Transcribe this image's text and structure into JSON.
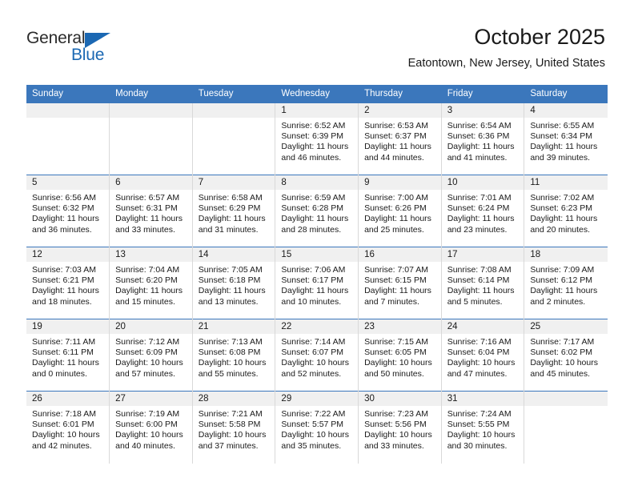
{
  "brand": {
    "name_line1": "General",
    "name_line2": "Blue",
    "accent_color": "#1b68b3"
  },
  "header": {
    "title": "October 2025",
    "subtitle": "Eatontown, New Jersey, United States"
  },
  "calendar": {
    "header_bg": "#3b77bc",
    "daynum_bg": "#f0f0f0",
    "weekday_headers": [
      "Sunday",
      "Monday",
      "Tuesday",
      "Wednesday",
      "Thursday",
      "Friday",
      "Saturday"
    ],
    "labels": {
      "sunrise": "Sunrise:",
      "sunset": "Sunset:",
      "daylight": "Daylight:"
    },
    "weeks": [
      [
        {
          "day": "",
          "empty": true
        },
        {
          "day": "",
          "empty": true
        },
        {
          "day": "",
          "empty": true
        },
        {
          "day": "1",
          "sunrise": "Sunrise: 6:52 AM",
          "sunset": "Sunset: 6:39 PM",
          "daylight": "Daylight: 11 hours and 46 minutes."
        },
        {
          "day": "2",
          "sunrise": "Sunrise: 6:53 AM",
          "sunset": "Sunset: 6:37 PM",
          "daylight": "Daylight: 11 hours and 44 minutes."
        },
        {
          "day": "3",
          "sunrise": "Sunrise: 6:54 AM",
          "sunset": "Sunset: 6:36 PM",
          "daylight": "Daylight: 11 hours and 41 minutes."
        },
        {
          "day": "4",
          "sunrise": "Sunrise: 6:55 AM",
          "sunset": "Sunset: 6:34 PM",
          "daylight": "Daylight: 11 hours and 39 minutes."
        }
      ],
      [
        {
          "day": "5",
          "sunrise": "Sunrise: 6:56 AM",
          "sunset": "Sunset: 6:32 PM",
          "daylight": "Daylight: 11 hours and 36 minutes."
        },
        {
          "day": "6",
          "sunrise": "Sunrise: 6:57 AM",
          "sunset": "Sunset: 6:31 PM",
          "daylight": "Daylight: 11 hours and 33 minutes."
        },
        {
          "day": "7",
          "sunrise": "Sunrise: 6:58 AM",
          "sunset": "Sunset: 6:29 PM",
          "daylight": "Daylight: 11 hours and 31 minutes."
        },
        {
          "day": "8",
          "sunrise": "Sunrise: 6:59 AM",
          "sunset": "Sunset: 6:28 PM",
          "daylight": "Daylight: 11 hours and 28 minutes."
        },
        {
          "day": "9",
          "sunrise": "Sunrise: 7:00 AM",
          "sunset": "Sunset: 6:26 PM",
          "daylight": "Daylight: 11 hours and 25 minutes."
        },
        {
          "day": "10",
          "sunrise": "Sunrise: 7:01 AM",
          "sunset": "Sunset: 6:24 PM",
          "daylight": "Daylight: 11 hours and 23 minutes."
        },
        {
          "day": "11",
          "sunrise": "Sunrise: 7:02 AM",
          "sunset": "Sunset: 6:23 PM",
          "daylight": "Daylight: 11 hours and 20 minutes."
        }
      ],
      [
        {
          "day": "12",
          "sunrise": "Sunrise: 7:03 AM",
          "sunset": "Sunset: 6:21 PM",
          "daylight": "Daylight: 11 hours and 18 minutes."
        },
        {
          "day": "13",
          "sunrise": "Sunrise: 7:04 AM",
          "sunset": "Sunset: 6:20 PM",
          "daylight": "Daylight: 11 hours and 15 minutes."
        },
        {
          "day": "14",
          "sunrise": "Sunrise: 7:05 AM",
          "sunset": "Sunset: 6:18 PM",
          "daylight": "Daylight: 11 hours and 13 minutes."
        },
        {
          "day": "15",
          "sunrise": "Sunrise: 7:06 AM",
          "sunset": "Sunset: 6:17 PM",
          "daylight": "Daylight: 11 hours and 10 minutes."
        },
        {
          "day": "16",
          "sunrise": "Sunrise: 7:07 AM",
          "sunset": "Sunset: 6:15 PM",
          "daylight": "Daylight: 11 hours and 7 minutes."
        },
        {
          "day": "17",
          "sunrise": "Sunrise: 7:08 AM",
          "sunset": "Sunset: 6:14 PM",
          "daylight": "Daylight: 11 hours and 5 minutes."
        },
        {
          "day": "18",
          "sunrise": "Sunrise: 7:09 AM",
          "sunset": "Sunset: 6:12 PM",
          "daylight": "Daylight: 11 hours and 2 minutes."
        }
      ],
      [
        {
          "day": "19",
          "sunrise": "Sunrise: 7:11 AM",
          "sunset": "Sunset: 6:11 PM",
          "daylight": "Daylight: 11 hours and 0 minutes."
        },
        {
          "day": "20",
          "sunrise": "Sunrise: 7:12 AM",
          "sunset": "Sunset: 6:09 PM",
          "daylight": "Daylight: 10 hours and 57 minutes."
        },
        {
          "day": "21",
          "sunrise": "Sunrise: 7:13 AM",
          "sunset": "Sunset: 6:08 PM",
          "daylight": "Daylight: 10 hours and 55 minutes."
        },
        {
          "day": "22",
          "sunrise": "Sunrise: 7:14 AM",
          "sunset": "Sunset: 6:07 PM",
          "daylight": "Daylight: 10 hours and 52 minutes."
        },
        {
          "day": "23",
          "sunrise": "Sunrise: 7:15 AM",
          "sunset": "Sunset: 6:05 PM",
          "daylight": "Daylight: 10 hours and 50 minutes."
        },
        {
          "day": "24",
          "sunrise": "Sunrise: 7:16 AM",
          "sunset": "Sunset: 6:04 PM",
          "daylight": "Daylight: 10 hours and 47 minutes."
        },
        {
          "day": "25",
          "sunrise": "Sunrise: 7:17 AM",
          "sunset": "Sunset: 6:02 PM",
          "daylight": "Daylight: 10 hours and 45 minutes."
        }
      ],
      [
        {
          "day": "26",
          "sunrise": "Sunrise: 7:18 AM",
          "sunset": "Sunset: 6:01 PM",
          "daylight": "Daylight: 10 hours and 42 minutes."
        },
        {
          "day": "27",
          "sunrise": "Sunrise: 7:19 AM",
          "sunset": "Sunset: 6:00 PM",
          "daylight": "Daylight: 10 hours and 40 minutes."
        },
        {
          "day": "28",
          "sunrise": "Sunrise: 7:21 AM",
          "sunset": "Sunset: 5:58 PM",
          "daylight": "Daylight: 10 hours and 37 minutes."
        },
        {
          "day": "29",
          "sunrise": "Sunrise: 7:22 AM",
          "sunset": "Sunset: 5:57 PM",
          "daylight": "Daylight: 10 hours and 35 minutes."
        },
        {
          "day": "30",
          "sunrise": "Sunrise: 7:23 AM",
          "sunset": "Sunset: 5:56 PM",
          "daylight": "Daylight: 10 hours and 33 minutes."
        },
        {
          "day": "31",
          "sunrise": "Sunrise: 7:24 AM",
          "sunset": "Sunset: 5:55 PM",
          "daylight": "Daylight: 10 hours and 30 minutes."
        },
        {
          "day": "",
          "empty": true
        }
      ]
    ]
  }
}
